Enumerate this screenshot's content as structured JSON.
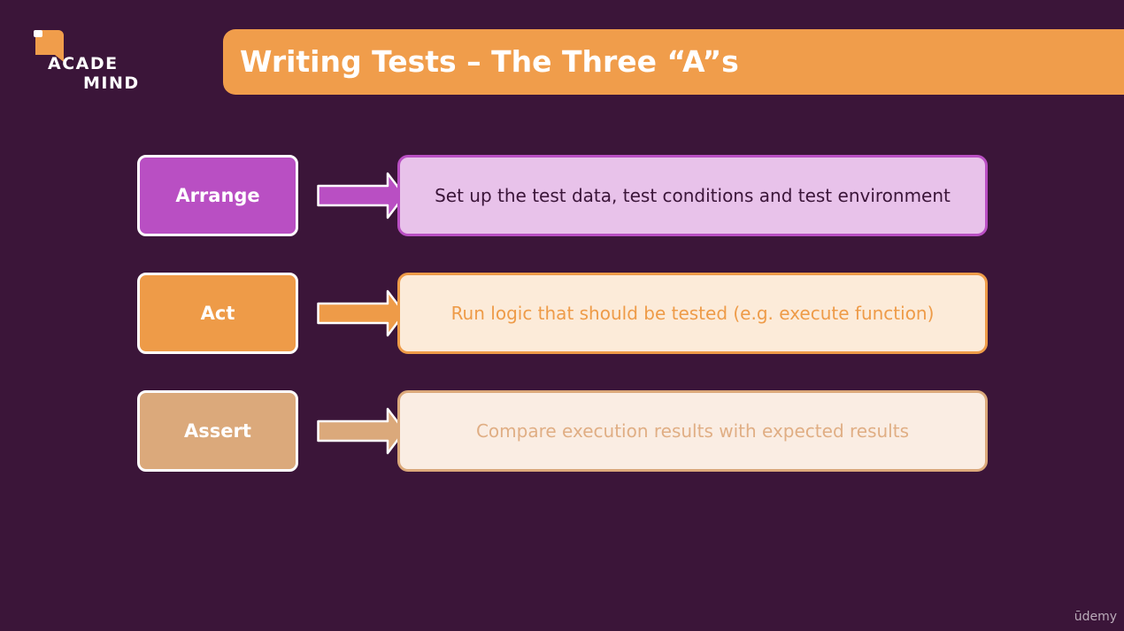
{
  "logo": {
    "line1": "ACADE",
    "line2": "MIND",
    "icon": "bookmark-icon"
  },
  "slide": {
    "title": "Writing Tests – The Three “A”s"
  },
  "rows": [
    {
      "label": "Arrange",
      "description": "Set up the test data, test conditions and test environment",
      "color": "#b94fc3",
      "light": "#e8c2ea"
    },
    {
      "label": "Act",
      "description": "Run logic that should be tested (e.g. execute function)",
      "color": "#ee9b48",
      "light": "#fcebd9"
    },
    {
      "label": "Assert",
      "description": "Compare execution results with expected results",
      "color": "#dba97b",
      "light": "#faede3"
    }
  ],
  "watermark": "ūdemy",
  "colors": {
    "background": "#3b1539",
    "banner": "#f09d4b"
  }
}
